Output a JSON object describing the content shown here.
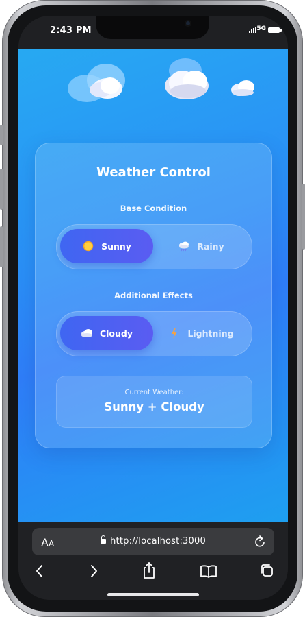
{
  "status_bar": {
    "time": "2:43 PM",
    "network": "5G"
  },
  "app": {
    "title": "Weather Control",
    "base_condition": {
      "label": "Base Condition",
      "options": [
        {
          "label": "Sunny",
          "icon": "sun-icon",
          "selected": true
        },
        {
          "label": "Rainy",
          "icon": "rain-cloud-icon",
          "selected": false
        }
      ]
    },
    "additional_effects": {
      "label": "Additional Effects",
      "options": [
        {
          "label": "Cloudy",
          "icon": "cloud-icon",
          "selected": true
        },
        {
          "label": "Lightning",
          "icon": "lightning-icon",
          "selected": false
        }
      ]
    },
    "current_weather": {
      "label": "Current Weather:",
      "value": "Sunny + Cloudy"
    }
  },
  "browser": {
    "aa_label": "A",
    "aa_small": "A",
    "url": "http://localhost:3000"
  },
  "colors": {
    "background_start": "#27a9f2",
    "background_end": "#1e9ff0",
    "active_option": "#4a60f2"
  }
}
